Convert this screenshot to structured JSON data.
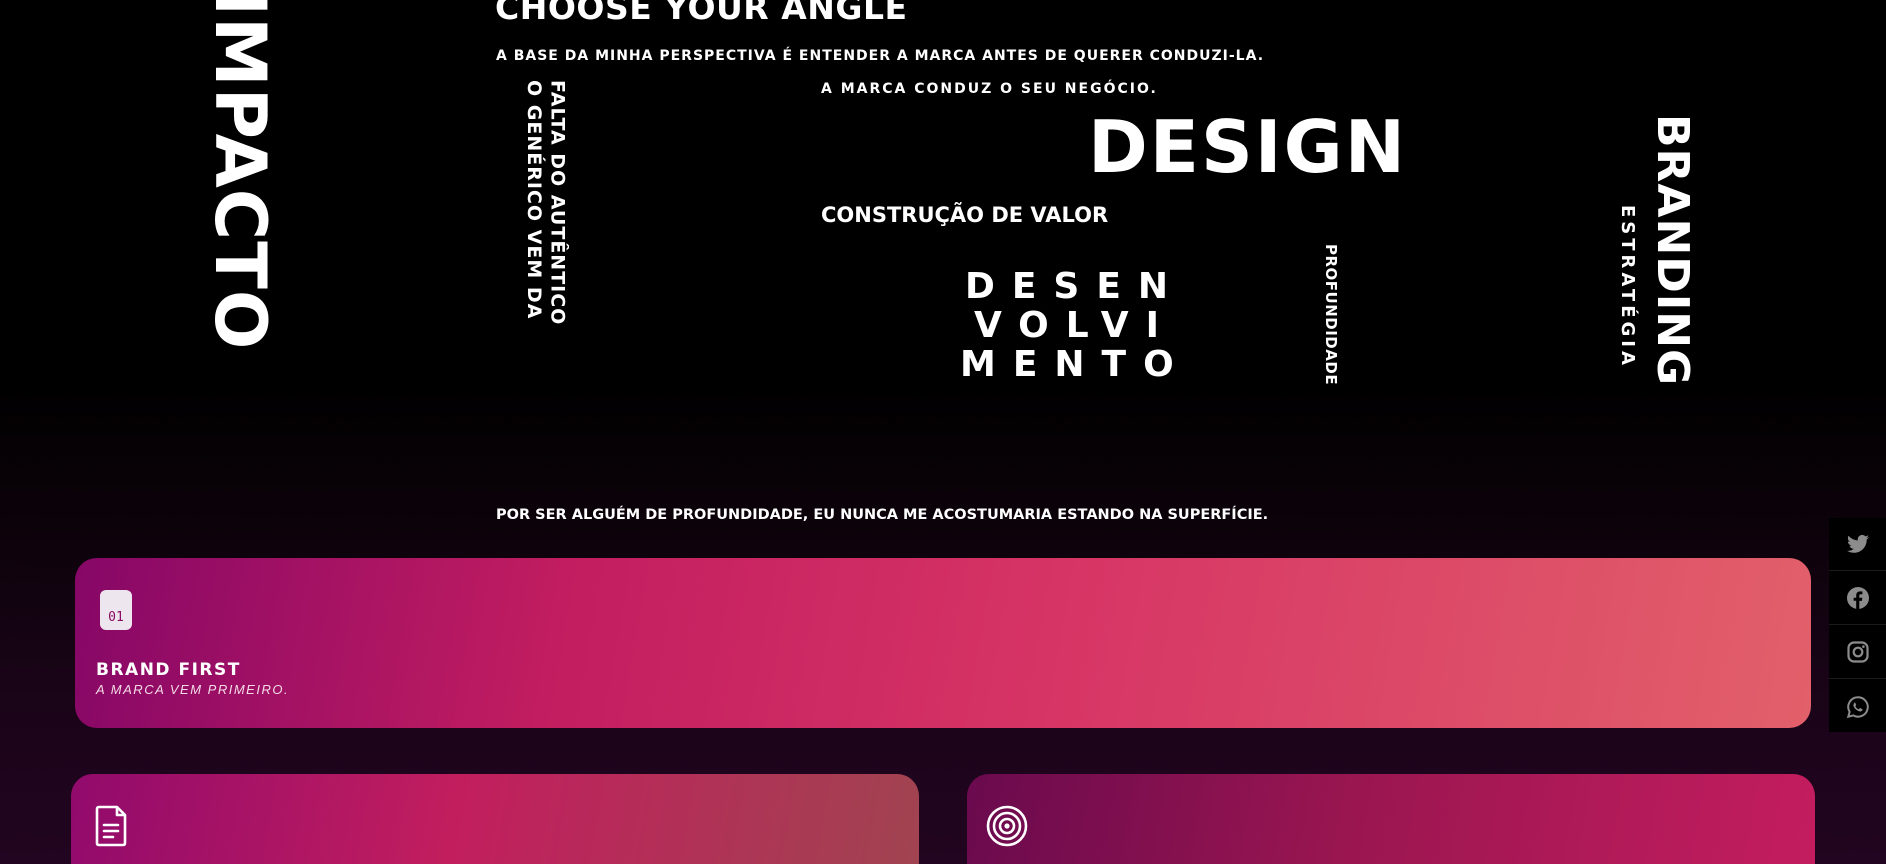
{
  "hero": {
    "vertical_left": "IMPACTO",
    "title": "CHOOSE YOUR ANGLE",
    "subtitle": "A BASE DA MINHA PERSPECTIVA É ENTENDER A MARCA ANTES DE QUERER CONDUZI-LA.",
    "vertical_phrase_line1": "FALTA DO AUTÊNTICO",
    "vertical_phrase_line2": "O GENÉRICO VEM DA",
    "tagline": "A MARCA CONDUZ O SEU NEGÓCIO.",
    "design_word": "DESIGN",
    "construction": "CONSTRUÇÃO DE VALOR",
    "desenvolvimento": [
      "DESEN",
      "VOLVI",
      "MENTO"
    ],
    "profundidade": "PROFUNDIDADE",
    "branding": "BRANDING",
    "estrategia": "ESTRATÉGIA",
    "quote": "POR SER ALGUÉM DE PROFUNDIDADE, EU NUNCA ME ACOSTUMARIA ESTANDO NA SUPERFÍCIE."
  },
  "cards": [
    {
      "number": "01",
      "title": "BRAND FIRST",
      "subtitle": "A MARCA VEM PRIMEIRO."
    },
    {
      "icon": "document-icon"
    },
    {
      "icon": "target-icon"
    }
  ],
  "social": [
    {
      "icon": "twitter-icon"
    },
    {
      "icon": "facebook-icon"
    },
    {
      "icon": "instagram-icon"
    },
    {
      "icon": "whatsapp-icon"
    }
  ],
  "colors": {
    "background": "#000000",
    "accent_pink": "#d63365",
    "accent_magenta": "#860767",
    "accent_coral": "#e2606a",
    "text": "#ffffff"
  }
}
